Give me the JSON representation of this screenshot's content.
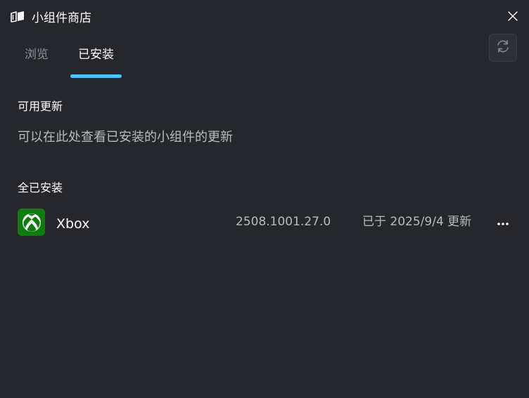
{
  "window": {
    "title": "小组件商店",
    "app_icon": "widget-store-icon",
    "close_icon": "close-icon"
  },
  "tabs": [
    {
      "label": "浏览",
      "selected": false
    },
    {
      "label": "已安装",
      "selected": true
    }
  ],
  "toolbar": {
    "refresh_icon": "refresh-icon"
  },
  "updates": {
    "heading": "可用更新",
    "description": "可以在此处查看已安装的小组件的更新"
  },
  "installed": {
    "heading": "全已安装",
    "items": [
      {
        "name": "Xbox",
        "icon": "xbox-logo-icon",
        "version": "2508.1001.27.0",
        "updated": "已于 2025/9/4 更新",
        "more_icon": "more-options-icon"
      }
    ]
  },
  "colors": {
    "background": "#25272c",
    "accent": "#4cc2ff",
    "xbox_green": "#107c10",
    "secondary_text": "#b9bbbf",
    "inactive_tab": "#8d9096"
  }
}
